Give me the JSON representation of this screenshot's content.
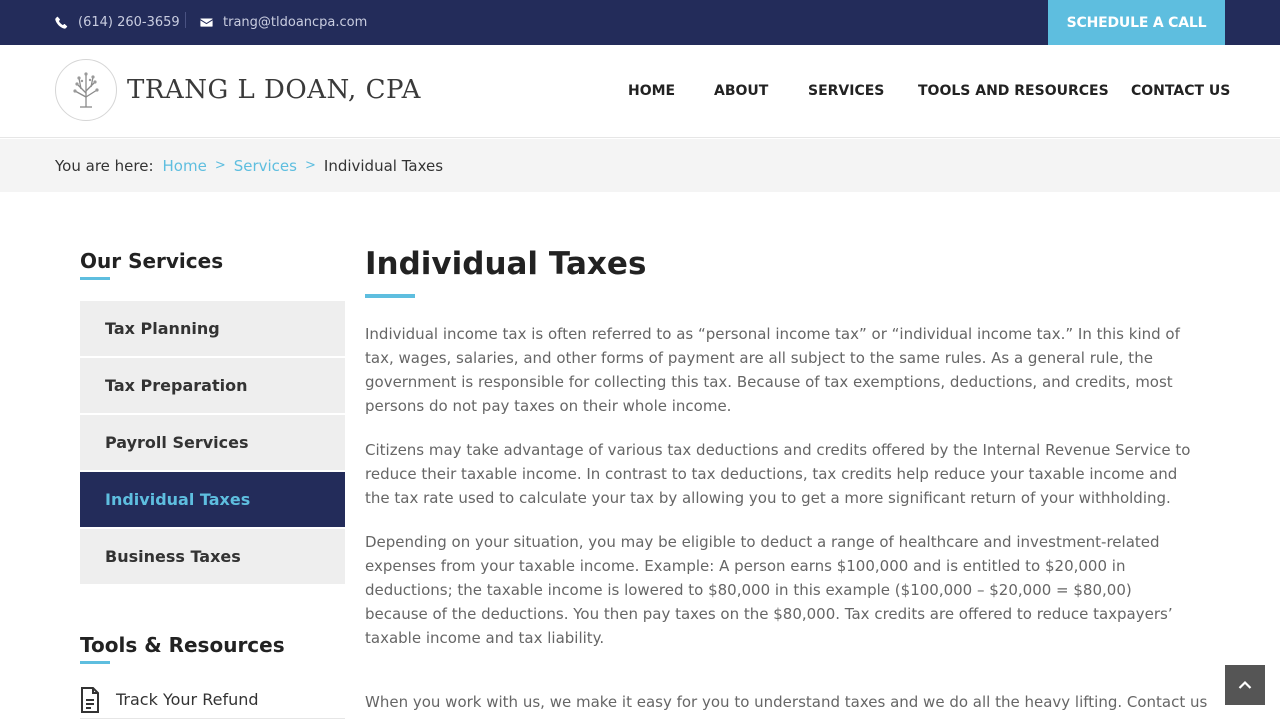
{
  "topbar": {
    "phone": "(614) 260-3659",
    "email": "trang@tldoancpa.com",
    "schedule_label": "SCHEDULE A CALL",
    "phone_icon": "phone-icon",
    "email_icon": "envelope-icon"
  },
  "logo": {
    "text": "TRANG L DOAN, CPA",
    "icon": "tree-logo-icon"
  },
  "nav": {
    "home": "HOME",
    "about": "ABOUT",
    "services": "SERVICES",
    "tools": "TOOLS AND RESOURCES",
    "contact": "CONTACT US"
  },
  "breadcrumb": {
    "prefix": "You are here:",
    "home": "Home",
    "services": "Services",
    "current": "Individual Taxes",
    "separator": ">"
  },
  "sidebar": {
    "services_heading": "Our Services",
    "services": [
      {
        "label": "Tax Planning"
      },
      {
        "label": "Tax Preparation"
      },
      {
        "label": "Payroll Services"
      },
      {
        "label": "Individual Taxes"
      },
      {
        "label": "Business Taxes"
      }
    ],
    "active_service": "Individual Taxes",
    "tools_heading": "Tools & Resources",
    "tools": [
      {
        "label": "Track Your Refund",
        "icon": "document-icon"
      }
    ]
  },
  "main": {
    "title": "Individual Taxes",
    "paragraphs": [
      "Individual income tax is often referred to as “personal income tax” or “individual income tax.” In this kind of tax, wages, salaries, and other forms of payment are all subject to the same rules. As a general rule, the government is responsible for collecting this tax. Because of tax exemptions, deductions, and credits, most persons do not pay taxes on their whole income.",
      "Citizens may take advantage of various tax deductions and credits offered by the Internal Revenue Service to reduce their taxable income. In contrast to tax deductions, tax credits help reduce your taxable income and the tax rate used to calculate your tax by allowing you to get a more significant return of your withholding.",
      "Depending on your situation, you may be eligible to deduct a range of healthcare and investment-related expenses from your taxable income. Example: A person earns $100,000 and is entitled to $20,000 in deductions; the taxable income is lowered to $80,000 in this example ($100,000 – $20,000 = $80,00) because of the deductions. You then pay taxes on the $80,000. Tax credits are offered to reduce taxpayers’ taxable income and tax liability.",
      "When you work with us, we make it easy for you to understand taxes and we do all the heavy lifting. Contact us"
    ]
  },
  "scroll_top_icon": "chevron-up-icon",
  "colors": {
    "navy": "#232c5a",
    "accent": "#5ebedf",
    "sidebar_bg": "#eeeeee",
    "breadcrumb_bg": "#f4f4f4"
  }
}
